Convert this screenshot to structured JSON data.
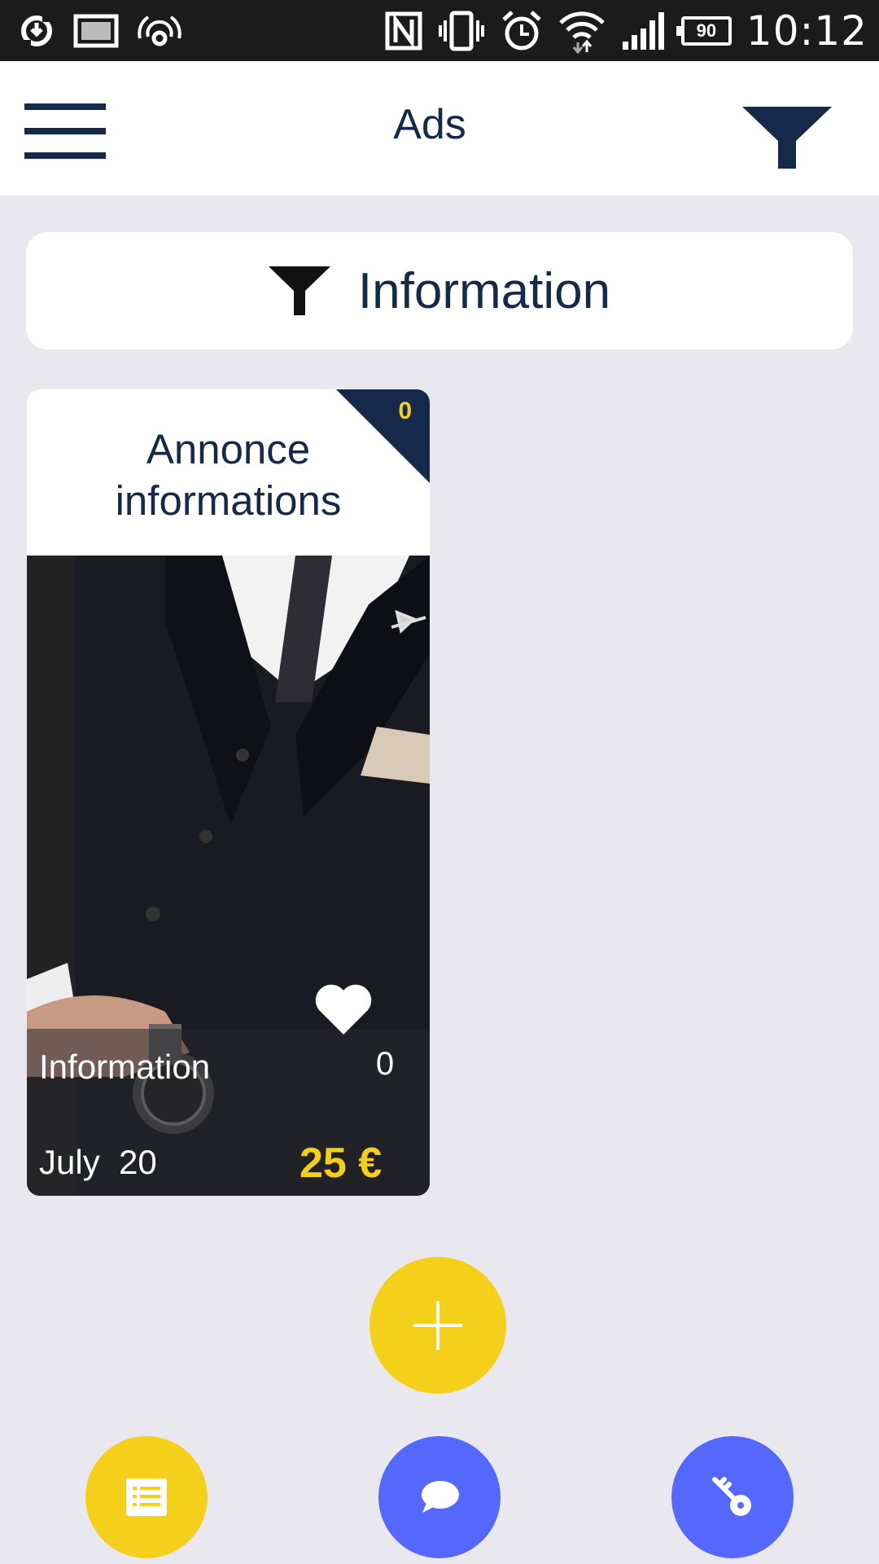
{
  "status_bar": {
    "time": "10:12",
    "battery": "90",
    "icons": [
      "sync-icon",
      "image-icon",
      "hotspot-icon",
      "nfc-icon",
      "vibrate-icon",
      "alarm-icon",
      "wifi-icon",
      "signal-icon",
      "battery-icon"
    ]
  },
  "app_bar": {
    "title": "Ads",
    "menu_icon": "hamburger-menu-icon",
    "filter_icon": "filter-funnel-icon"
  },
  "filter": {
    "label": "Information",
    "icon": "filter-funnel-icon"
  },
  "ads": [
    {
      "title_line1": "Annonce",
      "title_line2": "informations",
      "badge_count": "0",
      "category": "Information",
      "likes": "0",
      "date": "July  20",
      "price": "25 €",
      "image": "man-in-black-suit-photo"
    }
  ],
  "fabs": {
    "add_icon": "plus-icon",
    "list_icon": "list-icon",
    "chat_icon": "chat-bubble-icon",
    "key_icon": "key-icon"
  },
  "colors": {
    "primary_navy": "#15294a",
    "accent_yellow": "#f4d01a",
    "accent_blue": "#5468fd",
    "background": "#e9e8ee"
  }
}
